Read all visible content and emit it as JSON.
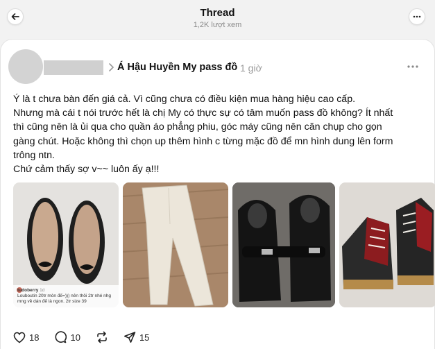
{
  "header": {
    "title": "Thread",
    "views": "1,2K lượt xem"
  },
  "post": {
    "group": "Á Hậu Huyền My pass đồ",
    "time": "1 giờ",
    "lines": [
      "Ý là t chưa bàn đến giá cả. Vì cũng chưa có điều kiện mua hàng hiệu cao cấp.",
      "Nhưng mà cái t nói trước hết là chị My có thực sự có tâm muốn pass đồ không? Ít nhất",
      "thì cũng nên là ủi qua cho quần áo phẳng phiu, góc máy cũng nên căn chụp cho gọn",
      "gàng chút. Hoặc không thì chọn up thêm hình c từng mặc đồ để mn hình dung lên form",
      "trông ntn.",
      "Chứ cảm thấy sợ v~~ luôn ấy ạ!!!"
    ],
    "media_caption": {
      "user": "tudoberry",
      "age": "1d",
      "text": "Louboutin 20tr mòn đế=))) nên thôi 2tr nhé nhg mng về dán đế là ngon. 2tr size 39"
    }
  },
  "actions": {
    "likes": "18",
    "comments": "10",
    "shares": "15"
  },
  "icons": [
    "arrow-left-icon",
    "more-horizontal-icon",
    "chevron-right-icon",
    "heart-icon",
    "comment-icon",
    "repost-icon",
    "send-icon"
  ]
}
